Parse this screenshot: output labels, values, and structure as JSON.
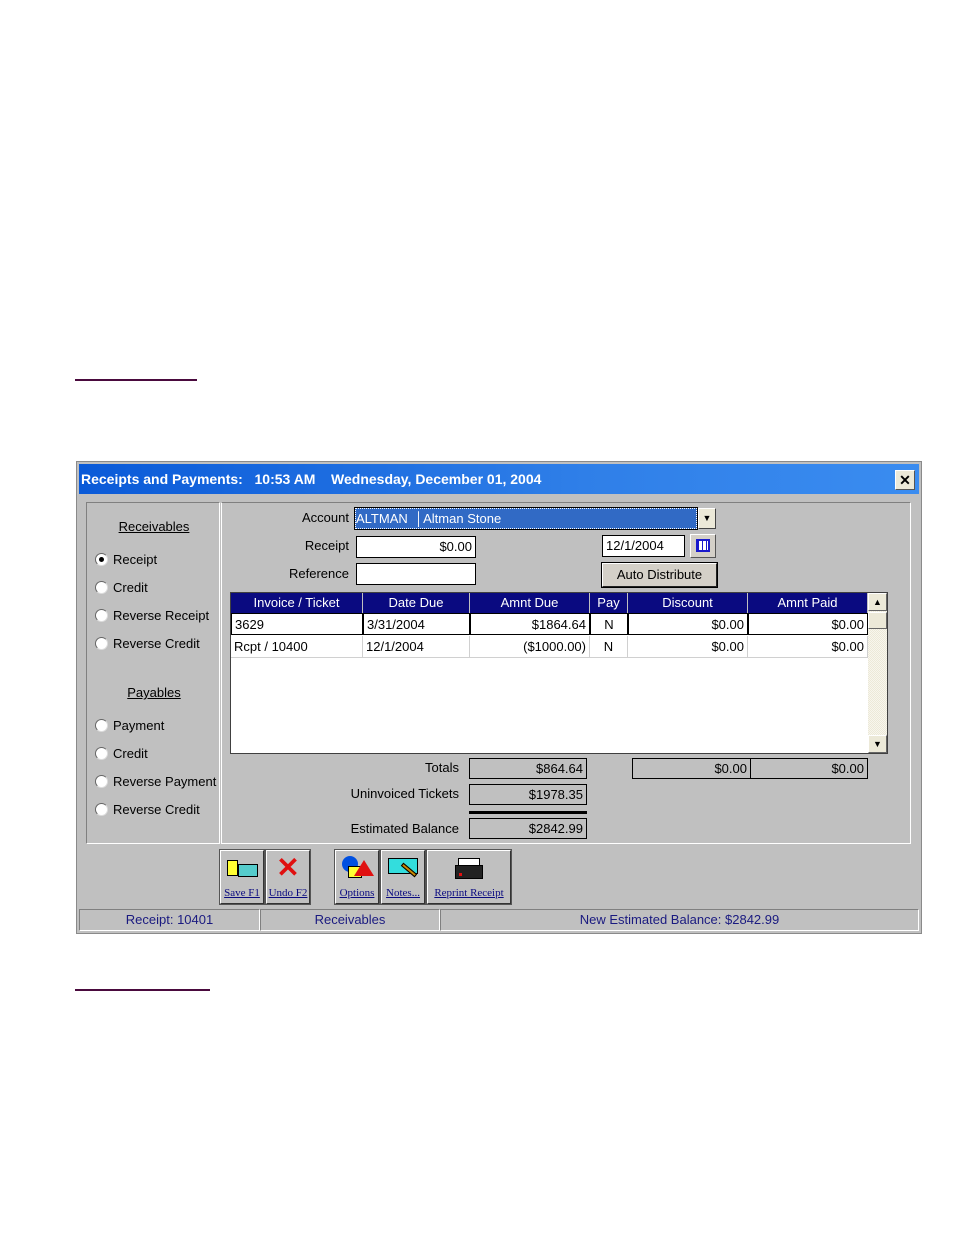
{
  "window": {
    "title": "Receipts and Payments:",
    "time": "10:53 AM",
    "date": "Wednesday, December 01, 2004",
    "close_label": "✕"
  },
  "receivables": {
    "title": "Receivables",
    "options": [
      {
        "label": "Receipt",
        "checked": true
      },
      {
        "label": "Credit",
        "checked": false
      },
      {
        "label": "Reverse Receipt",
        "checked": false
      },
      {
        "label": "Reverse Credit",
        "checked": false
      }
    ]
  },
  "payables": {
    "title": "Payables",
    "options": [
      {
        "label": "Payment",
        "checked": false
      },
      {
        "label": "Credit",
        "checked": false
      },
      {
        "label": "Reverse Payment",
        "checked": false
      },
      {
        "label": "Reverse Credit",
        "checked": false
      }
    ]
  },
  "form": {
    "account_label": "Account",
    "account_code": "ALTMAN",
    "account_name": "Altman Stone",
    "receipt_label": "Receipt",
    "receipt_value": "$0.00",
    "reference_label": "Reference",
    "reference_value": "",
    "date_value": "12/1/2004",
    "auto_distribute_label": "Auto Distribute"
  },
  "grid": {
    "columns": [
      "Invoice / Ticket",
      "Date Due",
      "Amnt Due",
      "Pay",
      "Discount",
      "Amnt Paid"
    ],
    "rows": [
      [
        "3629",
        "3/31/2004",
        "$1864.64",
        "N",
        "$0.00",
        "$0.00"
      ],
      [
        "Rcpt / 10400",
        "12/1/2004",
        "($1000.00)",
        "N",
        "$0.00",
        "$0.00"
      ]
    ]
  },
  "totals": {
    "totals_label": "Totals",
    "totals_value": "$864.64",
    "discount_total": "$0.00",
    "paid_total": "$0.00",
    "uninvoiced_label": "Uninvoiced Tickets",
    "uninvoiced_value": "$1978.35",
    "estimated_label": "Estimated Balance",
    "estimated_value": "$2842.99"
  },
  "toolbar": {
    "save_label": "Save F1",
    "undo_label": "Undo F2",
    "options_label": "Options",
    "notes_label": "Notes...",
    "reprint_label": "Reprint Receipt"
  },
  "status": {
    "receipt": "Receipt:  10401",
    "mode": "Receivables",
    "balance": "New Estimated Balance:  $2842.99"
  }
}
